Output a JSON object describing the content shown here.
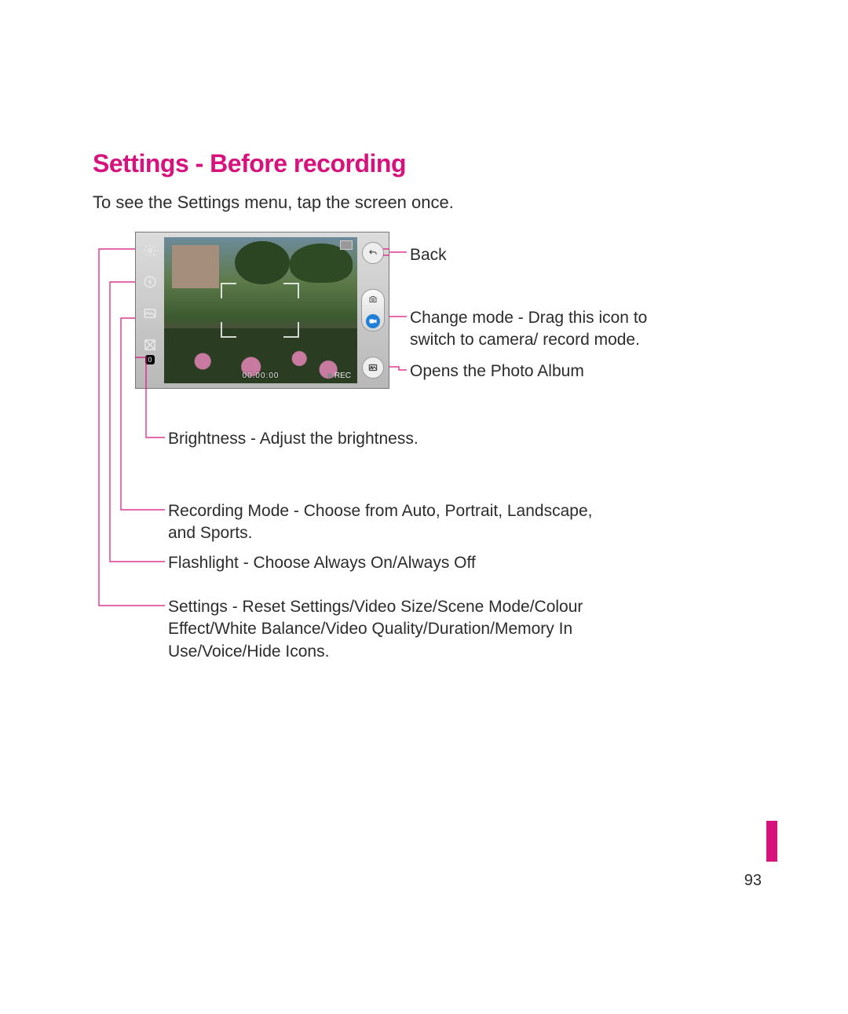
{
  "title": "Settings - Before recording",
  "intro": "To see the Settings menu, tap the screen once.",
  "timer": "00:00:00",
  "rec": "REC",
  "brightness_value": "0",
  "callouts": {
    "back": "Back",
    "mode": "Change mode - Drag this icon to switch to camera/ record mode.",
    "album": "Opens the Photo Album",
    "brightness": "Brightness - Adjust the brightness.",
    "recmode": "Recording Mode - Choose from Auto, Portrait, Landscape, and Sports.",
    "flash": "Flashlight - Choose Always On/Always Off",
    "settings": "Settings - Reset Settings/Video Size/Scene Mode/Colour Effect/White Balance/Video Quality/Duration/Memory In Use/Voice/Hide Icons."
  },
  "page_number": "93"
}
